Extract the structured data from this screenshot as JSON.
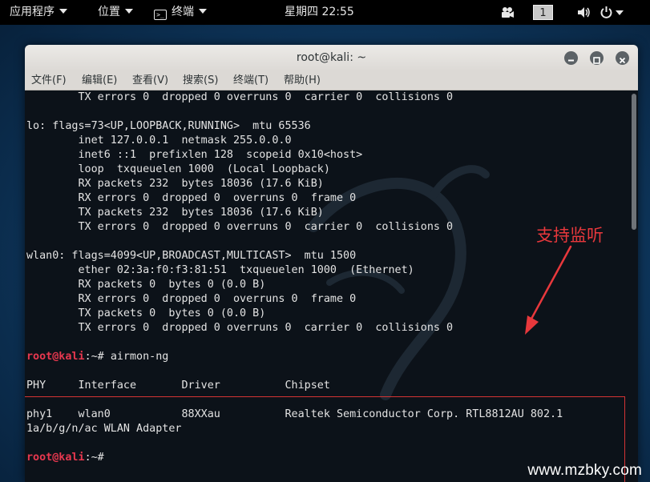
{
  "topbar": {
    "apps_menu": "应用程序",
    "places_menu": "位置",
    "terminal_menu": "终端",
    "clock": "星期四 22:55",
    "workspace": "1",
    "icons": [
      "screen-share-icon",
      "volume-icon",
      "power-icon",
      "chevron-down-icon"
    ]
  },
  "window": {
    "title": "root@kali: ~",
    "menu": [
      "文件(F)",
      "编辑(E)",
      "查看(V)",
      "搜索(S)",
      "终端(T)",
      "帮助(H)"
    ],
    "buttons": [
      "minimize",
      "maximize",
      "close"
    ]
  },
  "terminal": {
    "prompt_user": "root@kali",
    "prompt_path": ":~# ",
    "lines": [
      "        TX errors 0  dropped 0 overruns 0  carrier 0  collisions 0",
      "",
      "lo: flags=73<UP,LOOPBACK,RUNNING>  mtu 65536",
      "        inet 127.0.0.1  netmask 255.0.0.0",
      "        inet6 ::1  prefixlen 128  scopeid 0x10<host>",
      "        loop  txqueuelen 1000  (Local Loopback)",
      "        RX packets 232  bytes 18036 (17.6 KiB)",
      "        RX errors 0  dropped 0  overruns 0  frame 0",
      "        TX packets 232  bytes 18036 (17.6 KiB)",
      "        TX errors 0  dropped 0 overruns 0  carrier 0  collisions 0",
      "",
      "wlan0: flags=4099<UP,BROADCAST,MULTICAST>  mtu 1500",
      "        ether 02:3a:f0:f3:81:51  txqueuelen 1000  (Ethernet)",
      "        RX packets 0  bytes 0 (0.0 B)",
      "        RX errors 0  dropped 0  overruns 0  frame 0",
      "        TX packets 0  bytes 0 (0.0 B)",
      "        TX errors 0  dropped 0 overruns 0  carrier 0  collisions 0",
      ""
    ],
    "command1": "airmon-ng",
    "table_header": "PHY     Interface       Driver          Chipset",
    "table_row": "phy1    wlan0           88XXau          Realtek Semiconductor Corp. RTL8812AU 802.1",
    "table_row_wrap": "1a/b/g/n/ac WLAN Adapter",
    "command2": ""
  },
  "annotation": {
    "text": "支持监听",
    "color": "#e8383c"
  },
  "watermark": "www.mzbky.com",
  "colors": {
    "prompt": "#e8384f",
    "terminal_bg": "#0c1219",
    "highlight_box": "#d43434"
  }
}
